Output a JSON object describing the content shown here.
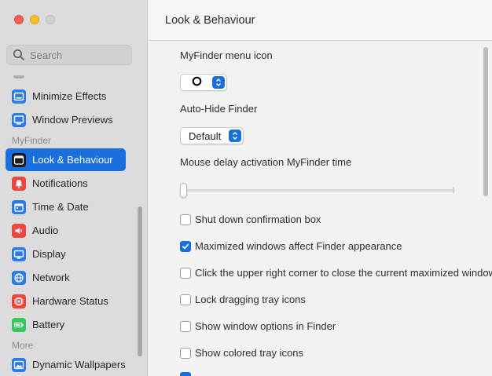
{
  "sidebar": {
    "search_placeholder": "Search",
    "sections": {
      "myfinder": "MyFinder",
      "more": "More"
    },
    "items": [
      {
        "label": "Minimize Effects",
        "icon": "minimize-effects-icon",
        "color": "#2f7be5"
      },
      {
        "label": "Window Previews",
        "icon": "window-previews-icon",
        "color": "#2f7be5"
      },
      {
        "label": "Look & Behaviour",
        "icon": "look-behaviour-icon",
        "color": "#1c1c1c",
        "active": true
      },
      {
        "label": "Notifications",
        "icon": "bell-icon",
        "color": "#f2453d"
      },
      {
        "label": "Time & Date",
        "icon": "calendar-icon",
        "color": "#2f7be5"
      },
      {
        "label": "Audio",
        "icon": "speaker-icon",
        "color": "#f2453d"
      },
      {
        "label": "Display",
        "icon": "display-icon",
        "color": "#2f7be5"
      },
      {
        "label": "Network",
        "icon": "globe-icon",
        "color": "#2f7be5"
      },
      {
        "label": "Hardware Status",
        "icon": "chip-icon",
        "color": "#f2453d"
      },
      {
        "label": "Battery",
        "icon": "battery-icon",
        "color": "#34c759"
      },
      {
        "label": "Dynamic Wallpapers",
        "icon": "wallpaper-icon",
        "color": "#2f7be5"
      }
    ]
  },
  "main": {
    "title": "Look & Behaviour",
    "menu_icon_label": "MyFinder menu icon",
    "auto_hide_label": "Auto-Hide Finder",
    "auto_hide_value": "Default",
    "mouse_delay_label": "Mouse delay activation MyFinder time",
    "mouse_delay_value": 0,
    "checkboxes": [
      {
        "label": "Shut down confirmation box",
        "checked": false
      },
      {
        "label": "Maximized windows affect Finder appearance",
        "checked": true
      },
      {
        "label": "Click the upper right corner to close the current maximized window",
        "checked": false
      },
      {
        "label": "Lock dragging tray icons",
        "checked": false
      },
      {
        "label": "Show window options in Finder",
        "checked": false
      },
      {
        "label": "Show colored tray icons",
        "checked": false
      }
    ]
  },
  "colors": {
    "accent": "#1a6fdc",
    "close": "#ff5f57",
    "minimize": "#febc2e"
  }
}
